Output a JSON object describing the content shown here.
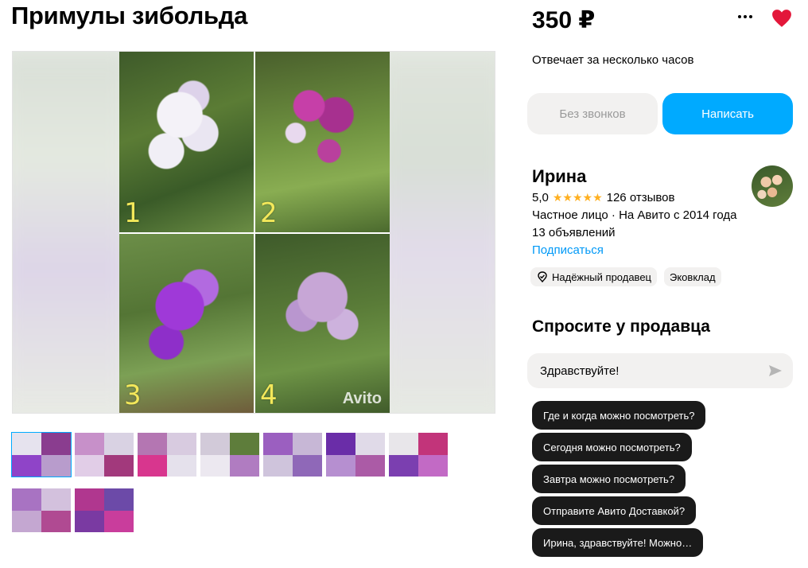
{
  "listing": {
    "title": "Примулы зибольда",
    "price": "350 ₽",
    "reply_time": "Отвечает за несколько часов"
  },
  "gallery": {
    "photo_numbers": [
      "1",
      "2",
      "3",
      "4"
    ],
    "watermark": "Avito",
    "thumbnail_count": 9,
    "active_thumbnail": 1
  },
  "actions": {
    "no_calls_label": "Без звонков",
    "write_label": "Написать",
    "more_icon": "more-dots-icon",
    "favorite_icon": "heart-icon"
  },
  "seller": {
    "name": "Ирина",
    "rating": "5,0",
    "stars": "★★★★★",
    "reviews": "126 отзывов",
    "info": "Частное лицо · На Авито с 2014 года",
    "ads_count": "13 объявлений",
    "subscribe_label": "Подписаться",
    "badges": [
      "Надёжный продавец",
      "Эковклад"
    ]
  },
  "ask": {
    "title": "Спросите у продавца",
    "input_value": "Здравствуйте!",
    "suggestions": [
      "Где и когда можно посмотреть?",
      "Сегодня можно посмотреть?",
      "Завтра можно посмотреть?",
      "Отправите Авито Доставкой?",
      "Ирина, здравствуйте! Можно…"
    ]
  },
  "colors": {
    "accent": "#00aaff",
    "favorite": "#e3173a",
    "link": "#0099f7",
    "star": "#ffb021"
  }
}
